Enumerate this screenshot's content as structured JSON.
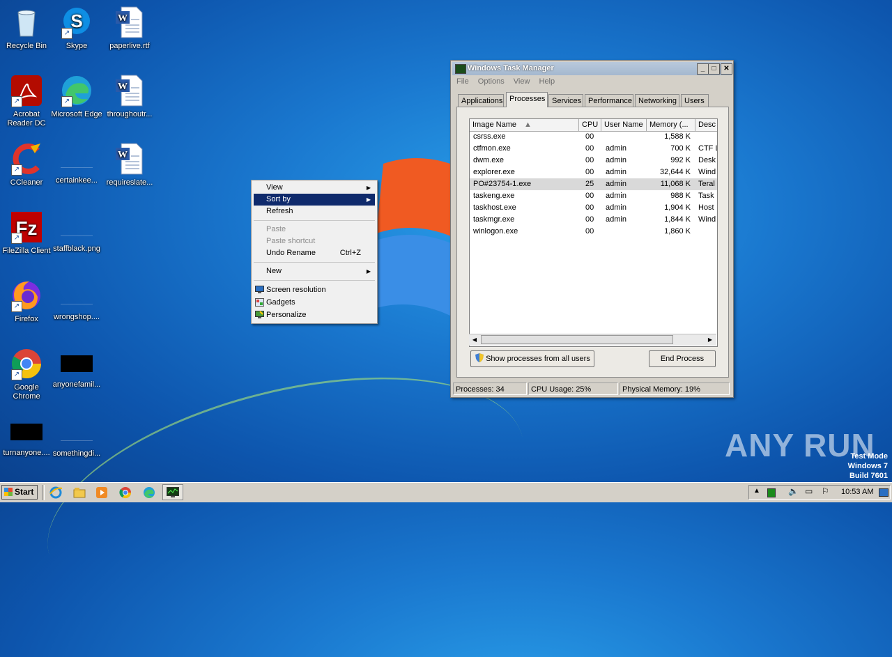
{
  "desktop": {
    "icons": [
      {
        "label": "Recycle Bin"
      },
      {
        "label": "Skype"
      },
      {
        "label": "paperlive.rtf"
      },
      {
        "label": "Acrobat Reader DC"
      },
      {
        "label": "Microsoft Edge"
      },
      {
        "label": "throughoutr..."
      },
      {
        "label": "CCleaner"
      },
      {
        "label": "certainkee..."
      },
      {
        "label": "requireslate..."
      },
      {
        "label": "FileZilla Client"
      },
      {
        "label": "staffblack.png"
      },
      {
        "label": "Firefox"
      },
      {
        "label": "wrongshop...."
      },
      {
        "label": "Google Chrome"
      },
      {
        "label": "anyonefamil..."
      },
      {
        "label": "turnanyone...."
      },
      {
        "label": "somethingdi..."
      }
    ]
  },
  "context_menu": {
    "items": [
      {
        "label": "View",
        "submenu": true
      },
      {
        "label": "Sort by",
        "submenu": true,
        "highlighted": true
      },
      {
        "label": "Refresh"
      },
      {
        "label": "Paste",
        "disabled": true
      },
      {
        "label": "Paste shortcut",
        "disabled": true
      },
      {
        "label": "Undo Rename",
        "shortcut": "Ctrl+Z"
      },
      {
        "label": "New",
        "submenu": true
      },
      {
        "label": "Screen resolution"
      },
      {
        "label": "Gadgets"
      },
      {
        "label": "Personalize"
      }
    ]
  },
  "task_manager": {
    "title": "Windows Task Manager",
    "menu": [
      "File",
      "Options",
      "View",
      "Help"
    ],
    "tabs": [
      "Applications",
      "Processes",
      "Services",
      "Performance",
      "Networking",
      "Users"
    ],
    "active_tab": "Processes",
    "columns": [
      "Image Name",
      "CPU",
      "User Name",
      "Memory (...",
      "Desc"
    ],
    "processes": [
      {
        "name": "csrss.exe",
        "cpu": "00",
        "user": "",
        "mem": "1,588 K",
        "desc": ""
      },
      {
        "name": "ctfmon.exe",
        "cpu": "00",
        "user": "admin",
        "mem": "700 K",
        "desc": "CTF L"
      },
      {
        "name": "dwm.exe",
        "cpu": "00",
        "user": "admin",
        "mem": "992 K",
        "desc": "Desk"
      },
      {
        "name": "explorer.exe",
        "cpu": "00",
        "user": "admin",
        "mem": "32,644 K",
        "desc": "Wind"
      },
      {
        "name": "PO#23754-1.exe",
        "cpu": "25",
        "user": "admin",
        "mem": "11,068 K",
        "desc": "Teral",
        "selected": true
      },
      {
        "name": "taskeng.exe",
        "cpu": "00",
        "user": "admin",
        "mem": "988 K",
        "desc": "Task"
      },
      {
        "name": "taskhost.exe",
        "cpu": "00",
        "user": "admin",
        "mem": "1,904 K",
        "desc": "Host"
      },
      {
        "name": "taskmgr.exe",
        "cpu": "00",
        "user": "admin",
        "mem": "1,844 K",
        "desc": "Wind"
      },
      {
        "name": "winlogon.exe",
        "cpu": "00",
        "user": "",
        "mem": "1,860 K",
        "desc": ""
      }
    ],
    "show_all_label": "Show processes from all users",
    "end_process_label": "End Process",
    "status": {
      "processes": "Processes: 34",
      "cpu": "CPU Usage: 25%",
      "memory": "Physical Memory: 19%"
    }
  },
  "taskbar": {
    "start_label": "Start",
    "clock": "10:53 AM"
  },
  "watermark": {
    "text": "ANY RUN"
  },
  "test_mode": {
    "line1": "Test Mode",
    "line2": "Windows 7",
    "line3": "Build 7601"
  }
}
